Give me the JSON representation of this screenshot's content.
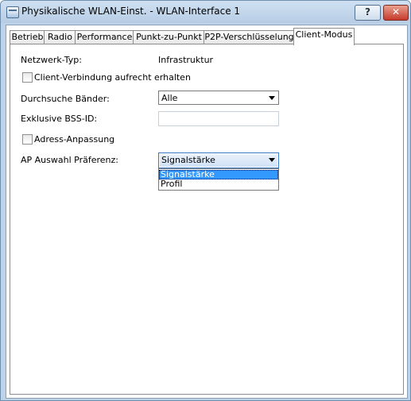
{
  "window": {
    "title": "Physikalische WLAN-Einst. - WLAN-Interface 1",
    "help_label": "?",
    "close_label": "✕"
  },
  "tabs": [
    {
      "label": "Betrieb"
    },
    {
      "label": "Radio"
    },
    {
      "label": "Performance"
    },
    {
      "label": "Punkt-zu-Punkt"
    },
    {
      "label": "P2P-Verschlüsselung"
    },
    {
      "label": "Client-Modus"
    }
  ],
  "form": {
    "network_type_label": "Netzwerk-Typ:",
    "network_type_value": "Infrastruktur",
    "keep_client_connection_label": "Client-Verbindung aufrecht erhalten",
    "keep_client_connection_checked": false,
    "scan_bands_label": "Durchsuche Bänder:",
    "scan_bands_value": "Alle",
    "exclusive_bssid_label": "Exklusive BSS-ID:",
    "exclusive_bssid_value": "",
    "address_adaptation_label": "Adress-Anpassung",
    "address_adaptation_checked": false,
    "ap_selection_label": "AP Auswahl Präferenz:",
    "ap_selection_value": "Signalstärke",
    "ap_selection_options": [
      "Signalstärke",
      "Profil"
    ]
  }
}
